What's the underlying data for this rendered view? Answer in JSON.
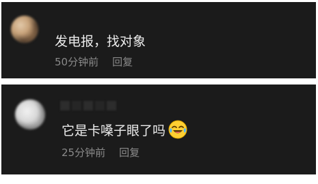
{
  "comments": [
    {
      "text": "发电报，找对象",
      "time": "50分钟前",
      "reply_label": "回复"
    },
    {
      "text": "它是卡嗓子眼了吗",
      "emoji": "crying-laughing-emoji",
      "time": "25分钟前",
      "reply_label": "回复"
    }
  ],
  "colors": {
    "card_background": "#1b1b1b",
    "comment_text": "#ececec",
    "meta_text": "#8a8a8a",
    "page_background": "#ffffff"
  }
}
